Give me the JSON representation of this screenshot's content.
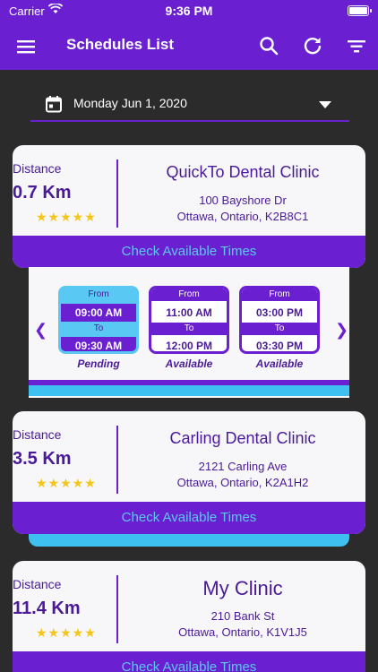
{
  "status_bar": {
    "carrier": "Carrier",
    "time": "9:36 PM"
  },
  "app_bar": {
    "title": "Schedules List"
  },
  "date_selector": {
    "date": "Monday Jun 1, 2020"
  },
  "clinics": [
    {
      "distance_label": "Distance",
      "distance": "0.7 Km",
      "rating_stars": "★★★★★",
      "name": "QuickTo Dental Clinic",
      "address_line1": "100 Bayshore Dr",
      "address_line2": "Ottawa, Ontario, K2B8C1",
      "check_label": "Check Available Times"
    },
    {
      "distance_label": "Distance",
      "distance": "3.5 Km",
      "rating_stars": "★★★★★",
      "name": "Carling Dental Clinic",
      "address_line1": "2121 Carling Ave",
      "address_line2": "Ottawa, Ontario, K2A1H2",
      "check_label": "Check Available Times"
    },
    {
      "distance_label": "Distance",
      "distance": "11.4 Km",
      "rating_stars": "★★★★★",
      "name": "My Clinic",
      "address_line1": "210 Bank St",
      "address_line2": "Ottawa, Ontario, K1V1J5",
      "check_label": "Check Available Times"
    }
  ],
  "time_slots": [
    {
      "from_label": "From",
      "from": "09:00 AM",
      "to_label": "To",
      "to": "09:30 AM",
      "status": "Pending"
    },
    {
      "from_label": "From",
      "from": "11:00 AM",
      "to_label": "To",
      "to": "12:00 PM",
      "status": "Available"
    },
    {
      "from_label": "From",
      "from": "03:00 PM",
      "to_label": "To",
      "to": "03:30 PM",
      "status": "Available"
    }
  ],
  "icons": {
    "menu": "menu-icon",
    "search": "search-icon",
    "refresh": "refresh-icon",
    "filter": "filter-icon",
    "calendar": "calendar-icon",
    "dropdown": "chevron-down-icon",
    "prev": "chevron-left-icon",
    "next": "chevron-right-icon"
  },
  "colors": {
    "primary": "#6a1fd1",
    "accent": "#3ec0f0",
    "text_primary": "#4a1a99",
    "star": "#f5c518",
    "background": "#2b2b2b"
  }
}
